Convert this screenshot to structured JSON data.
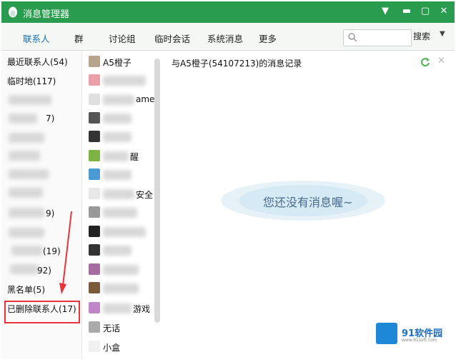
{
  "window": {
    "title": "消息管理器",
    "accent": "#2a9c4f"
  },
  "toolbar": {
    "tabs": [
      "联系人",
      "群",
      "讨论组",
      "临时会话",
      "系统消息",
      "更多"
    ],
    "search_button": "搜索"
  },
  "left_panel": {
    "items": [
      {
        "label": "最近联系人(54)"
      },
      {
        "label": "临时地(117)"
      },
      {
        "label": "7)"
      },
      {
        "label": "9)"
      },
      {
        "label": "(19)"
      },
      {
        "label": "92)"
      },
      {
        "label": "黑名单(5)"
      },
      {
        "label": "已删除联系人(17)"
      }
    ]
  },
  "contacts": [
    {
      "name": "A5橙子"
    },
    {
      "name": "ame"
    },
    {
      "name": "醒"
    },
    {
      "name": "安全"
    },
    {
      "name": "游戏"
    },
    {
      "name": "无话"
    },
    {
      "name": "小盒"
    }
  ],
  "main": {
    "record_title": "与A5橙子(54107213)的消息记录",
    "empty_message": "您还没有消息喔~"
  },
  "watermark": {
    "text": "91软件园",
    "url": "www.91soft.com"
  }
}
